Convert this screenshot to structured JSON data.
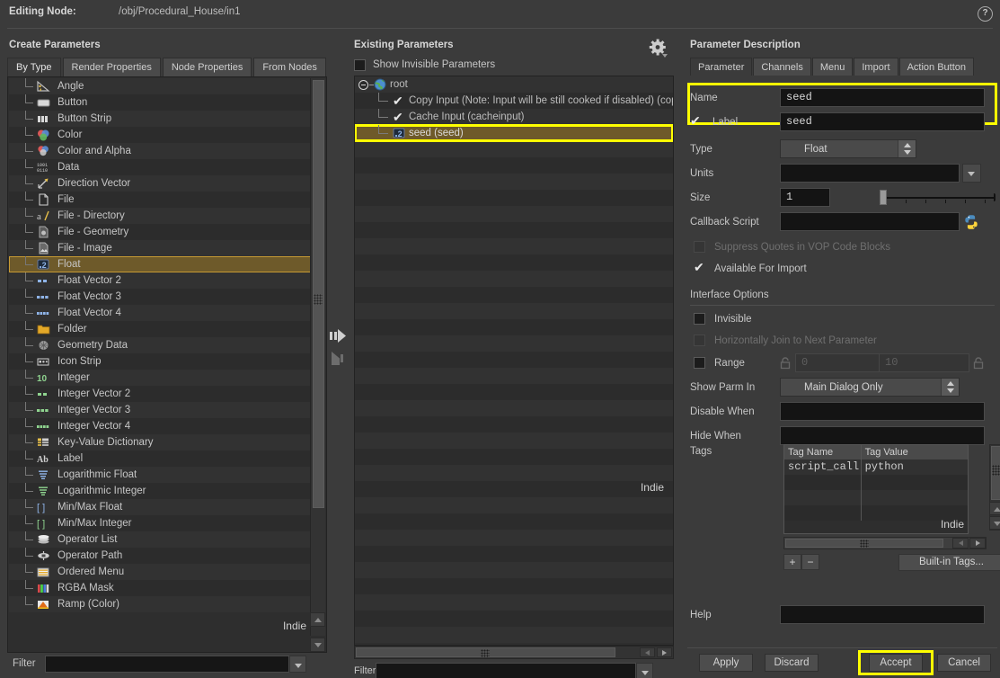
{
  "header": {
    "editing_node_label": "Editing Node:",
    "editing_node_value": "/obj/Procedural_House/in1",
    "help_icon": "help-icon"
  },
  "left_panel": {
    "title": "Create Parameters",
    "tabs": [
      {
        "label": "By Type",
        "active": true
      },
      {
        "label": "Render Properties",
        "active": false
      },
      {
        "label": "Node Properties",
        "active": false
      },
      {
        "label": "From Nodes",
        "active": false
      }
    ],
    "items": [
      {
        "label": "Angle",
        "icon": "angle-icon",
        "selected": false
      },
      {
        "label": "Button",
        "icon": "button-icon",
        "selected": false
      },
      {
        "label": "Button Strip",
        "icon": "button-strip-icon",
        "selected": false
      },
      {
        "label": "Color",
        "icon": "color-icon",
        "selected": false
      },
      {
        "label": "Color and Alpha",
        "icon": "color-alpha-icon",
        "selected": false
      },
      {
        "label": "Data",
        "icon": "data-icon",
        "selected": false
      },
      {
        "label": "Direction Vector",
        "icon": "direction-vector-icon",
        "selected": false
      },
      {
        "label": "File",
        "icon": "file-icon",
        "selected": false
      },
      {
        "label": "File - Directory",
        "icon": "file-directory-icon",
        "selected": false
      },
      {
        "label": "File - Geometry",
        "icon": "file-geometry-icon",
        "selected": false
      },
      {
        "label": "File - Image",
        "icon": "file-image-icon",
        "selected": false
      },
      {
        "label": "Float",
        "icon": "float-icon",
        "selected": true
      },
      {
        "label": "Float Vector 2",
        "icon": "float-vector2-icon",
        "selected": false
      },
      {
        "label": "Float Vector 3",
        "icon": "float-vector3-icon",
        "selected": false
      },
      {
        "label": "Float Vector 4",
        "icon": "float-vector4-icon",
        "selected": false
      },
      {
        "label": "Folder",
        "icon": "folder-icon",
        "selected": false
      },
      {
        "label": "Geometry Data",
        "icon": "geometry-data-icon",
        "selected": false
      },
      {
        "label": "Icon Strip",
        "icon": "icon-strip-icon",
        "selected": false
      },
      {
        "label": "Integer",
        "icon": "integer-icon",
        "selected": false
      },
      {
        "label": "Integer Vector 2",
        "icon": "integer-vector2-icon",
        "selected": false
      },
      {
        "label": "Integer Vector 3",
        "icon": "integer-vector3-icon",
        "selected": false
      },
      {
        "label": "Integer Vector 4",
        "icon": "integer-vector4-icon",
        "selected": false
      },
      {
        "label": "Key-Value Dictionary",
        "icon": "key-value-dictionary-icon",
        "selected": false
      },
      {
        "label": "Label",
        "icon": "label-icon",
        "selected": false
      },
      {
        "label": "Logarithmic Float",
        "icon": "log-float-icon",
        "selected": false
      },
      {
        "label": "Logarithmic Integer",
        "icon": "log-integer-icon",
        "selected": false
      },
      {
        "label": "Min/Max Float",
        "icon": "minmax-float-icon",
        "selected": false
      },
      {
        "label": "Min/Max Integer",
        "icon": "minmax-integer-icon",
        "selected": false
      },
      {
        "label": "Operator List",
        "icon": "operator-list-icon",
        "selected": false
      },
      {
        "label": "Operator Path",
        "icon": "operator-path-icon",
        "selected": false
      },
      {
        "label": "Ordered Menu",
        "icon": "ordered-menu-icon",
        "selected": false
      },
      {
        "label": "RGBA Mask",
        "icon": "rgba-mask-icon",
        "selected": false
      },
      {
        "label": "Ramp (Color)",
        "icon": "ramp-color-icon",
        "selected": false
      }
    ],
    "watermark": "Indie",
    "filter": {
      "label": "Filter",
      "value": "",
      "placeholder": ""
    }
  },
  "transfer": {
    "add_label": "add-parameter-arrow",
    "remove_label": "remove-parameter-arrow"
  },
  "middle_panel": {
    "title": "Existing Parameters",
    "gear_icon": "gear-icon",
    "show_invisible": {
      "label": "Show Invisible Parameters",
      "checked": false
    },
    "tree": [
      {
        "label": "root",
        "icon": "globe-icon",
        "depth": 0,
        "selected": false
      },
      {
        "label": "Copy Input (Note: Input will be still cooked if disabled) (copy",
        "icon": "check-icon",
        "depth": 1,
        "selected": false
      },
      {
        "label": "Cache Input (cacheinput)",
        "icon": "check-icon",
        "depth": 1,
        "selected": false
      },
      {
        "label": "seed (seed)",
        "icon": "float-icon",
        "depth": 1,
        "selected": true
      }
    ],
    "watermark": "Indie",
    "filter": {
      "label": "Filter",
      "value": "",
      "placeholder": ""
    }
  },
  "right_panel": {
    "title": "Parameter Description",
    "tabs": [
      {
        "label": "Parameter",
        "active": true
      },
      {
        "label": "Channels",
        "active": false
      },
      {
        "label": "Menu",
        "active": false
      },
      {
        "label": "Import",
        "active": false
      },
      {
        "label": "Action Button",
        "active": false
      }
    ],
    "name": {
      "label": "Name",
      "value": "seed"
    },
    "label_field": {
      "label": "Label",
      "value": "seed",
      "checked": true
    },
    "type": {
      "label": "Type",
      "value": "Float"
    },
    "units": {
      "label": "Units",
      "value": ""
    },
    "size": {
      "label": "Size",
      "value": "1"
    },
    "callback_script": {
      "label": "Callback Script",
      "value": "",
      "icon": "python-icon"
    },
    "suppress_quotes": {
      "label": "Suppress Quotes in VOP Code Blocks",
      "checked": false,
      "disabled": true
    },
    "available_for_import": {
      "label": "Available For Import",
      "checked": true
    },
    "interface_options_title": "Interface Options",
    "invisible": {
      "label": "Invisible",
      "checked": false
    },
    "horizontally_join": {
      "label": "Horizontally Join to Next Parameter",
      "checked": false,
      "disabled": true
    },
    "range": {
      "label": "Range",
      "checked": false,
      "min": "0",
      "max": "10",
      "lock_icon": "lock-icon"
    },
    "show_parm_in": {
      "label": "Show Parm In",
      "value": "Main Dialog Only"
    },
    "disable_when": {
      "label": "Disable When",
      "value": ""
    },
    "hide_when": {
      "label": "Hide When",
      "value": ""
    },
    "tags": {
      "label": "Tags",
      "columns": [
        "Tag Name",
        "Tag Value"
      ],
      "rows": [
        [
          "script_call",
          "python"
        ],
        [
          "",
          ""
        ],
        [
          "",
          ""
        ],
        [
          "",
          ""
        ]
      ],
      "watermark": "Indie",
      "add_button": "+",
      "remove_button": "−",
      "builtin_button": "Built-in Tags..."
    },
    "help": {
      "label": "Help",
      "value": ""
    }
  },
  "footer": {
    "apply": "Apply",
    "discard": "Discard",
    "accept": "Accept",
    "cancel": "Cancel"
  },
  "colors": {
    "selection_amber": "#6e5a2a",
    "highlight_yellow": "#ffff00",
    "panel_bg": "#3b3b3b",
    "list_bg": "#2e2e2e"
  }
}
